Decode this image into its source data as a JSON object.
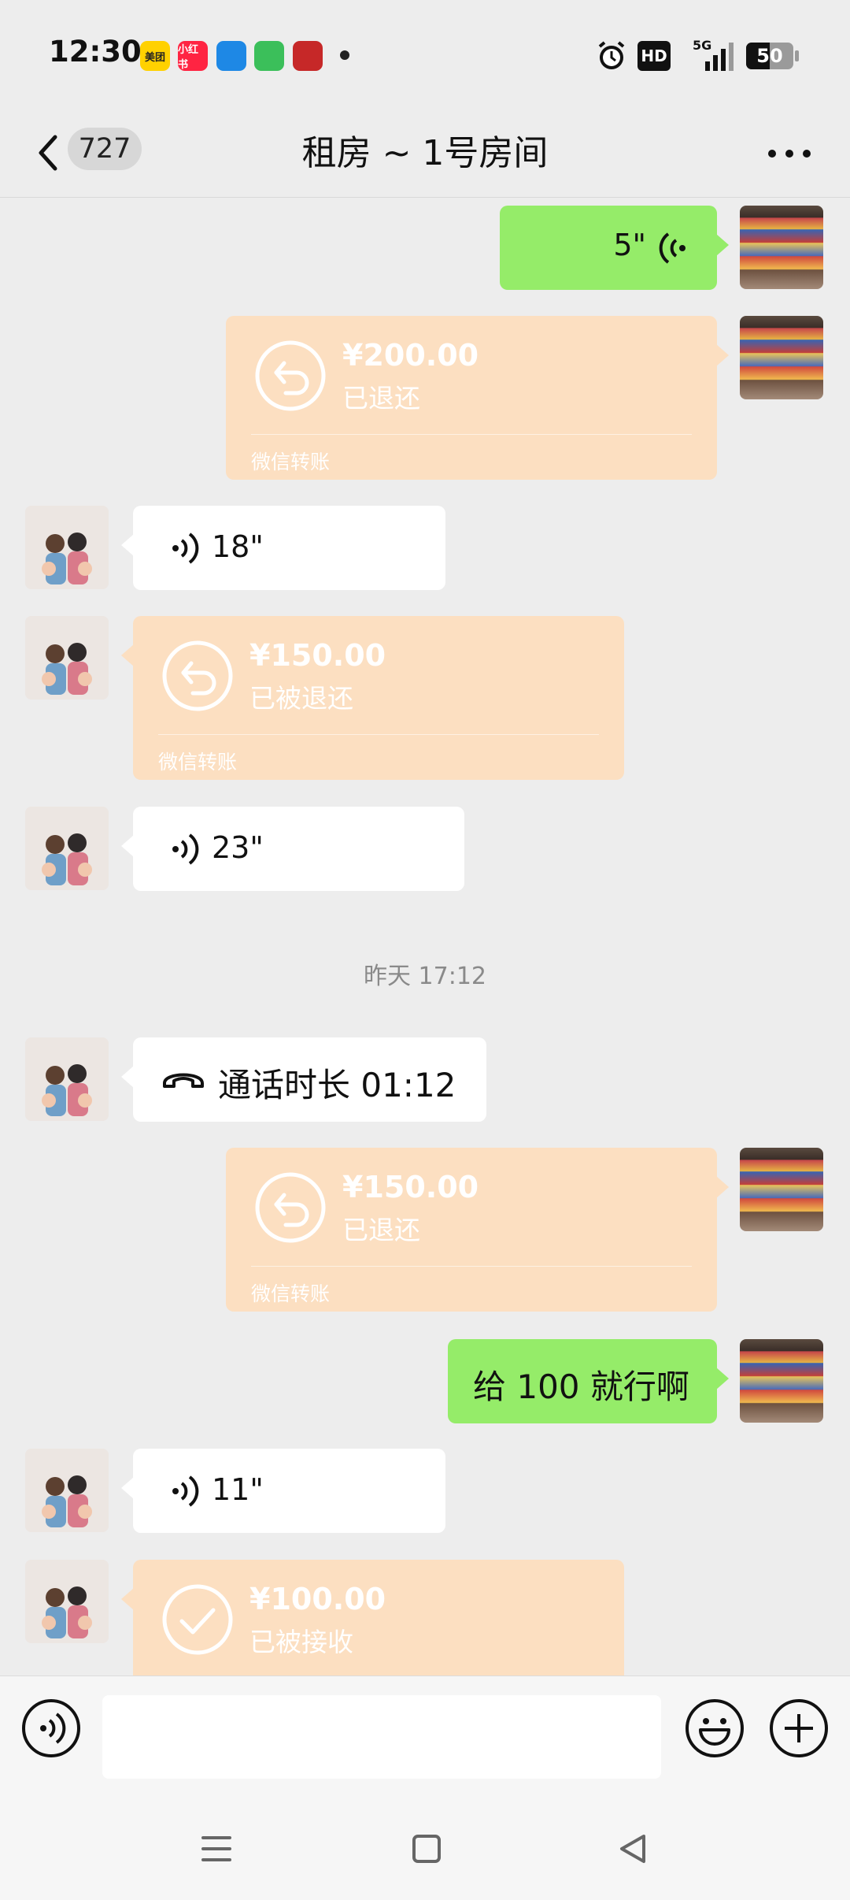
{
  "status_bar": {
    "time": "12:30",
    "apps": [
      {
        "name": "meituan-app-icon",
        "text": "美团",
        "color": "#ffd100",
        "fg": "#222"
      },
      {
        "name": "xiaohongshu-app-icon",
        "text": "小红书",
        "color": "#ff2442",
        "fg": "#fff"
      },
      {
        "name": "feishu-app-icon",
        "text": "",
        "color": "#1e88e5",
        "fg": "#fff"
      },
      {
        "name": "messages-app-icon",
        "text": "",
        "color": "#3bbf5a",
        "fg": "#fff"
      },
      {
        "name": "bank-app-icon",
        "text": "",
        "color": "#c62828",
        "fg": "#fff"
      }
    ],
    "hd_label": "HD",
    "network_label": "5G",
    "battery_level": "50"
  },
  "header": {
    "unread_count": "727",
    "title": "租房 ~ 1号房间"
  },
  "messages": {
    "m1_voice_duration": "5\"",
    "m2_transfer": {
      "amount": "¥200.00",
      "status": "已退还",
      "source": "微信转账"
    },
    "m3_voice_duration": "18\"",
    "m4_transfer": {
      "amount": "¥150.00",
      "status": "已被退还",
      "source": "微信转账"
    },
    "m5_voice_duration": "23\"",
    "timestamp": "昨天 17:12",
    "m6_call": "通话时长 01:12",
    "m7_transfer": {
      "amount": "¥150.00",
      "status": "已退还",
      "source": "微信转账"
    },
    "m8_text": "给 100 就行啊",
    "m9_voice_duration": "11\"",
    "m10_transfer": {
      "amount": "¥100.00",
      "status": "已被接收"
    }
  },
  "input": {
    "value": "",
    "placeholder": ""
  },
  "colors": {
    "sent_bubble": "#95ec69",
    "received_bubble": "#ffffff",
    "transfer_card": "#fcdfc1",
    "background": "#ededed"
  }
}
